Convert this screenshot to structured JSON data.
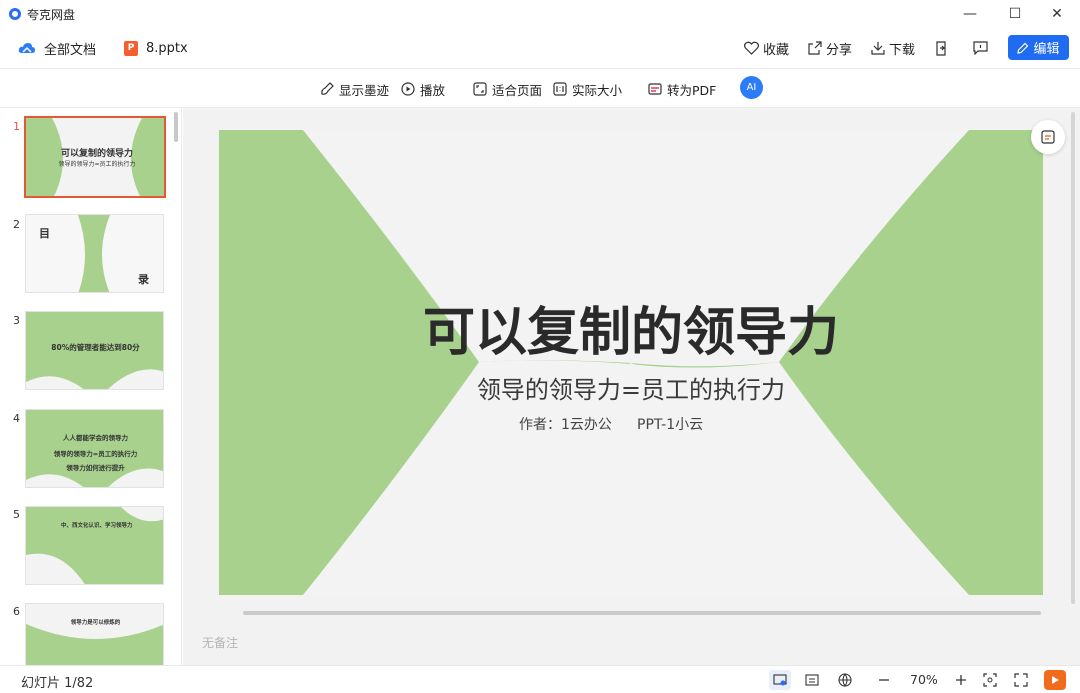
{
  "window": {
    "title": "夸克网盘",
    "controls": [
      "—",
      "☐",
      "✕"
    ]
  },
  "header": {
    "breadcrumb_root": "全部文档",
    "file_badge": "P",
    "file_name": "8.pptx",
    "actions": {
      "favorite": "收藏",
      "share": "分享",
      "download": "下载",
      "edit": "编辑"
    }
  },
  "toolbar": {
    "show_ink": "显示墨迹",
    "play": "播放",
    "fit_page": "适合页面",
    "actual_size": "实际大小",
    "to_pdf": "转为PDF",
    "ai": "AI"
  },
  "sidebar": {
    "thumbnails": [
      {
        "num": "1",
        "title": "可以复制的领导力",
        "sub": "领导的领导力=员工的执行力"
      },
      {
        "num": "2",
        "title": "目",
        "sub": "录"
      },
      {
        "num": "3",
        "title": "80%的管理者能达到80分",
        "sub": ""
      },
      {
        "num": "4",
        "title": "人人都能学会的领导力",
        "sub": "领导的领导力=员工的执行力",
        "extra": "领导力如何进行提升"
      },
      {
        "num": "5",
        "title": "中、西文化认识、学习领导力",
        "sub": "",
        "extra": ""
      },
      {
        "num": "6",
        "title": "领导力是可以修炼的",
        "sub": "",
        "extra": ""
      }
    ]
  },
  "slide": {
    "title": "可以复制的领导力",
    "subtitle": "领导的领导力=员工的执行力",
    "author": "作者：1云办公",
    "ppt": "PPT-1小云"
  },
  "notes_placeholder": "无备注",
  "status": {
    "slide_counter": "幻灯片 1/82",
    "zoom": "70%"
  },
  "colors": {
    "accent": "#1f6bf2",
    "slide_green": "#a8d18d",
    "selected_border": "#e35a32",
    "pptx_badge": "#f1612f"
  }
}
